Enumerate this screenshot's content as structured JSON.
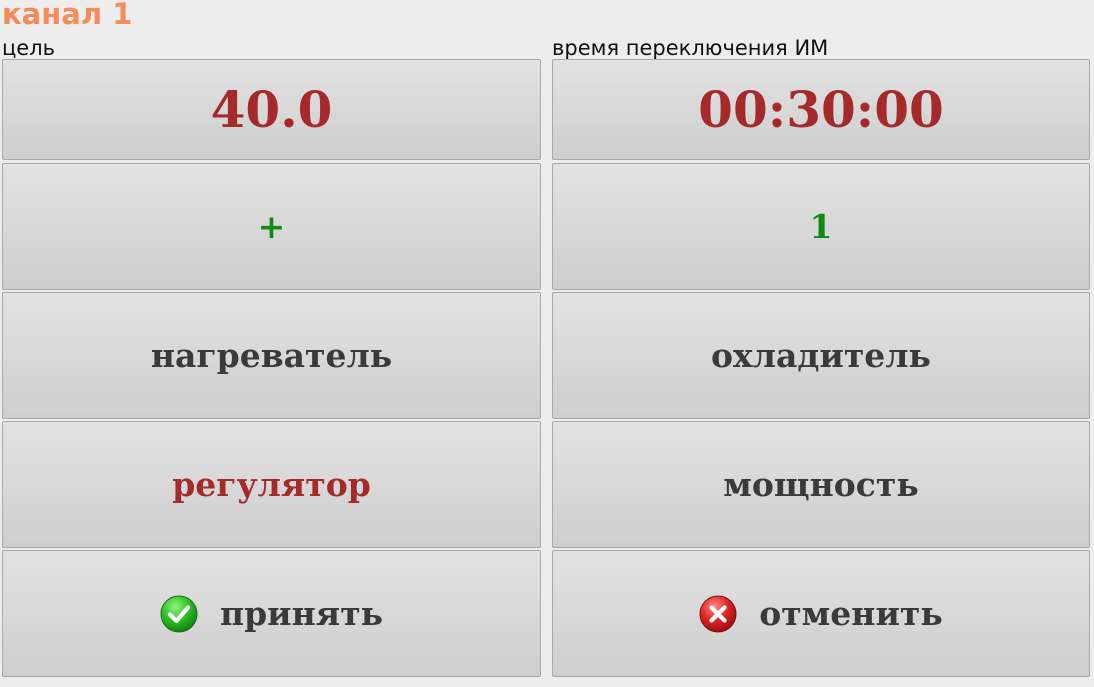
{
  "header": {
    "title": "канал 1"
  },
  "labels": {
    "target": "цель",
    "switch_time": "время переключения ИМ"
  },
  "fields": {
    "target_value": "40.0",
    "switch_time_value": "00:30:00",
    "sign_value": "+",
    "count_value": "1"
  },
  "buttons": {
    "heater": "нагреватель",
    "cooler": "охладитель",
    "regulator": "регулятор",
    "power": "мощность",
    "accept": "принять",
    "cancel": "отменить"
  },
  "colors": {
    "title": "#f58b5b",
    "value_red": "#a52a2a",
    "value_green": "#128a12",
    "text_dark": "#3a3a3a"
  },
  "icons": {
    "accept": "check-circle-icon",
    "cancel": "x-circle-icon"
  }
}
